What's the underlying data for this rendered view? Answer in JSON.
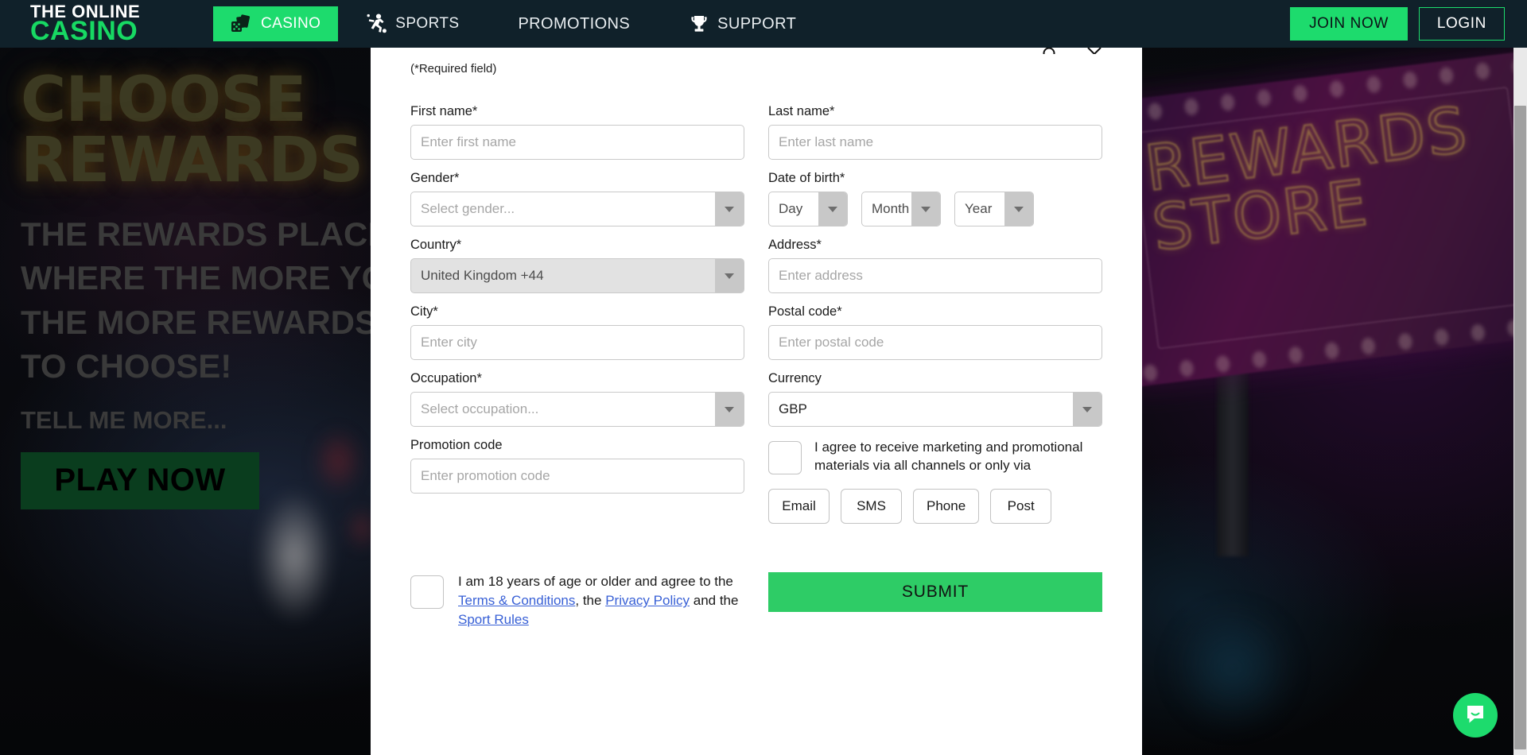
{
  "header": {
    "brand_line1": "THE ONLINE",
    "brand_line2": "CASINO",
    "nav": [
      {
        "key": "casino",
        "label": "CASINO",
        "icon": "dice-cards-icon",
        "active": true
      },
      {
        "key": "sports",
        "label": "SPORTS",
        "icon": "running-person-icon",
        "active": false
      },
      {
        "key": "promotions",
        "label": "PROMOTIONS",
        "icon": "",
        "active": false
      },
      {
        "key": "support",
        "label": "SUPPORT",
        "icon": "trophy-icon",
        "active": false
      }
    ],
    "join_now_label": "JOIN NOW",
    "login_label": "LOGIN",
    "accent_green": "#1ddb6d",
    "bar_color": "#10212a"
  },
  "hero": {
    "neon_line1": "CHOOSE",
    "neon_line2": "REWARDS",
    "sub_line1": "THE REWARDS PLACE",
    "sub_line2": "WHERE THE MORE YOU PLAY,",
    "sub_line3": "THE MORE REWARDS YOU HAVE",
    "sub_line4": "TO CHOOSE!",
    "tell_me_more": "TELL ME MORE...",
    "play_now_label": "PLAY NOW",
    "sign_text_line1": "REWARDS",
    "sign_text_line2": "STORE"
  },
  "form": {
    "required_note": "(*Required field)",
    "first_name": {
      "label": "First name*",
      "placeholder": "Enter first name",
      "value": ""
    },
    "last_name": {
      "label": "Last name*",
      "placeholder": "Enter last name",
      "value": ""
    },
    "gender": {
      "label": "Gender*",
      "selected": "Select gender...",
      "is_placeholder": true,
      "disabled": false
    },
    "date_of_birth": {
      "label": "Date of birth*",
      "day": {
        "selected": "Day"
      },
      "month": {
        "selected": "Month"
      },
      "year": {
        "selected": "Year"
      }
    },
    "country": {
      "label": "Country*",
      "selected": "United Kingdom +44",
      "is_placeholder": false,
      "disabled": true
    },
    "address": {
      "label": "Address*",
      "placeholder": "Enter address",
      "value": ""
    },
    "city": {
      "label": "City*",
      "placeholder": "Enter city",
      "value": ""
    },
    "postal_code": {
      "label": "Postal code*",
      "placeholder": "Enter postal code",
      "value": ""
    },
    "occupation": {
      "label": "Occupation*",
      "selected": "Select occupation...",
      "is_placeholder": true,
      "disabled": false
    },
    "currency": {
      "label": "Currency",
      "selected": "GBP",
      "is_placeholder": false,
      "disabled": false
    },
    "promotion_code": {
      "label": "Promotion code",
      "placeholder": "Enter promotion code",
      "value": ""
    },
    "marketing": {
      "text": "I agree to receive marketing and promotional materials via all channels or only via",
      "checked": false,
      "channels": [
        "Email",
        "SMS",
        "Phone",
        "Post"
      ]
    },
    "terms": {
      "checked": false,
      "text_part1": "I am 18 years of age or older and agree to the ",
      "link1": "Terms & Conditions",
      "text_part2": ", the ",
      "link2": "Privacy Policy",
      "text_part3": " and the ",
      "link3": "Sport Rules"
    },
    "submit_label": "SUBMIT"
  },
  "chat": {
    "icon": "chat-bubble-smile-icon"
  },
  "scrollbar": {
    "orientation": "vertical"
  }
}
